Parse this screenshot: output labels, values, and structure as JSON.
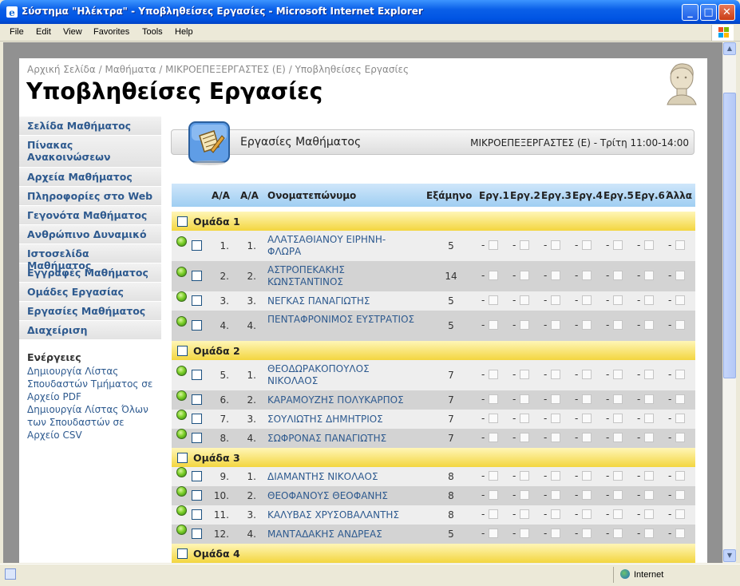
{
  "window": {
    "title": "Σύστημα \"Ηλέκτρα\" - Υποβληθείσες Εργασίες - Microsoft Internet Explorer",
    "controls": [
      "_",
      "□",
      "✕"
    ]
  },
  "menubar": {
    "items": [
      {
        "label": "File",
        "key": "F"
      },
      {
        "label": "Edit",
        "key": "E"
      },
      {
        "label": "View",
        "key": "V"
      },
      {
        "label": "Favorites",
        "key": "a"
      },
      {
        "label": "Tools",
        "key": "T"
      },
      {
        "label": "Help",
        "key": "H"
      }
    ]
  },
  "breadcrumb": {
    "home": "Αρχική Σελίδα",
    "courses": "Μαθήματα",
    "course": "ΜΙΚΡΟΕΠΕΞΕΡΓΑΣΤΕΣ (Ε)",
    "current": "Υποβληθείσες Εργασίες",
    "separator": "/"
  },
  "page_title": "Υποβληθείσες Εργασίες",
  "sidebar": {
    "items": [
      {
        "label": "Σελίδα Μαθήματος"
      },
      {
        "label": "Πίνακας Ανακοινώσεων"
      },
      {
        "label": "Αρχεία Μαθήματος"
      },
      {
        "label": "Πληροφορίες στο Web"
      },
      {
        "label": "Γεγονότα Μαθήματος"
      },
      {
        "label": "Ανθρώπινο Δυναμικό"
      },
      {
        "label": "Ιστοσελίδα Μαθήματος"
      },
      {
        "label": "Εγγραφές Μαθήματος"
      },
      {
        "label": "Ομάδες Εργασίας"
      },
      {
        "label": "Εργασίες Μαθήματος"
      },
      {
        "label": "Διαχείριση"
      }
    ],
    "actions_header": "Ενέργειες",
    "actions": [
      {
        "label": "Δημιουργία Λίστας Σπουδαστών Τμήματος σε Αρχείο PDF"
      },
      {
        "label": "Δημιουργία Λίστας Όλων των Σπουδαστών σε Αρχείο CSV"
      }
    ]
  },
  "course_box": {
    "title": "Εργασίες Μαθήματος",
    "info": "ΜΙΚΡΟΕΠΕΞΕΡΓΑΣΤΕΣ (Ε) - Τρίτη 11:00-14:00"
  },
  "table": {
    "headers": {
      "aa1": "Α/Α",
      "aa2": "Α/Α",
      "name": "Ονοματεπώνυμο",
      "semester": "Εξάμηνο",
      "asg": [
        "Εργ.1",
        "Εργ.2",
        "Εργ.3",
        "Εργ.4",
        "Εργ.5",
        "Εργ.6",
        "Άλλα"
      ]
    },
    "dash": "-",
    "groups": [
      {
        "label": "Ομάδα 1",
        "rows": [
          {
            "n1": "1.",
            "n2": "1.",
            "name": "ΑΛΑΤΣΑΘΙΑΝΟΥ ΕΙΡΗΝΗ-ΦΛΩΡΑ",
            "sem": "5",
            "tall": true
          },
          {
            "n1": "2.",
            "n2": "2.",
            "name": "ΑΣΤΡΟΠΕΚΑΚΗΣ ΚΩΝΣΤΑΝΤΙΝΟΣ",
            "sem": "14",
            "tall": true
          },
          {
            "n1": "3.",
            "n2": "3.",
            "name": "ΝΕΓΚΑΣ ΠΑΝΑΓΙΩΤΗΣ",
            "sem": "5",
            "tall": false
          },
          {
            "n1": "4.",
            "n2": "4.",
            "name": "ΠΕΝΤΑΦΡΟΝΙΜΟΣ ΕΥΣΤΡΑΤΙΟΣ",
            "sem": "5",
            "tall": true
          }
        ]
      },
      {
        "label": "Ομάδα 2",
        "rows": [
          {
            "n1": "5.",
            "n2": "1.",
            "name": "ΘΕΟΔΩΡΑΚΟΠΟΥΛΟΣ ΝΙΚΟΛΑΟΣ",
            "sem": "7",
            "tall": true
          },
          {
            "n1": "6.",
            "n2": "2.",
            "name": "ΚΑΡΑΜΟΥΖΗΣ ΠΟΛΥΚΑΡΠΟΣ",
            "sem": "7",
            "tall": false
          },
          {
            "n1": "7.",
            "n2": "3.",
            "name": "ΣΟΥΛΙΩΤΗΣ ΔΗΜΗΤΡΙΟΣ",
            "sem": "7",
            "tall": false
          },
          {
            "n1": "8.",
            "n2": "4.",
            "name": "ΣΩΦΡΟΝΑΣ ΠΑΝΑΓΙΩΤΗΣ",
            "sem": "7",
            "tall": false
          }
        ]
      },
      {
        "label": "Ομάδα 3",
        "rows": [
          {
            "n1": "9.",
            "n2": "1.",
            "name": "ΔΙΑΜΑΝΤΗΣ ΝΙΚΟΛΑΟΣ",
            "sem": "8",
            "tall": false
          },
          {
            "n1": "10.",
            "n2": "2.",
            "name": "ΘΕΟΦΑΝΟΥΣ ΘΕΟΦΑΝΗΣ",
            "sem": "8",
            "tall": false
          },
          {
            "n1": "11.",
            "n2": "3.",
            "name": "ΚΑΛΥΒΑΣ ΧΡΥΣΟΒΑΛΑΝΤΗΣ",
            "sem": "8",
            "tall": false
          },
          {
            "n1": "12.",
            "n2": "4.",
            "name": "ΜΑΝΤΑΔΑΚΗΣ ΑΝΔΡΕΑΣ",
            "sem": "5",
            "tall": false
          }
        ]
      },
      {
        "label": "Ομάδα 4",
        "rows": []
      }
    ]
  },
  "statusbar": {
    "zone": "Internet"
  },
  "colors": {
    "titlebar": "#0054e3",
    "link": "#2e5a8f",
    "group_band": "#f3d640",
    "header_band": "#9fcef2",
    "status_green": "#7ed12a"
  },
  "icons": {
    "app": "ie-icon",
    "windows": "windows-flag-icon",
    "course": "assignment-icon",
    "logo": "statue-head-logo",
    "status": "green-dot-icon"
  }
}
